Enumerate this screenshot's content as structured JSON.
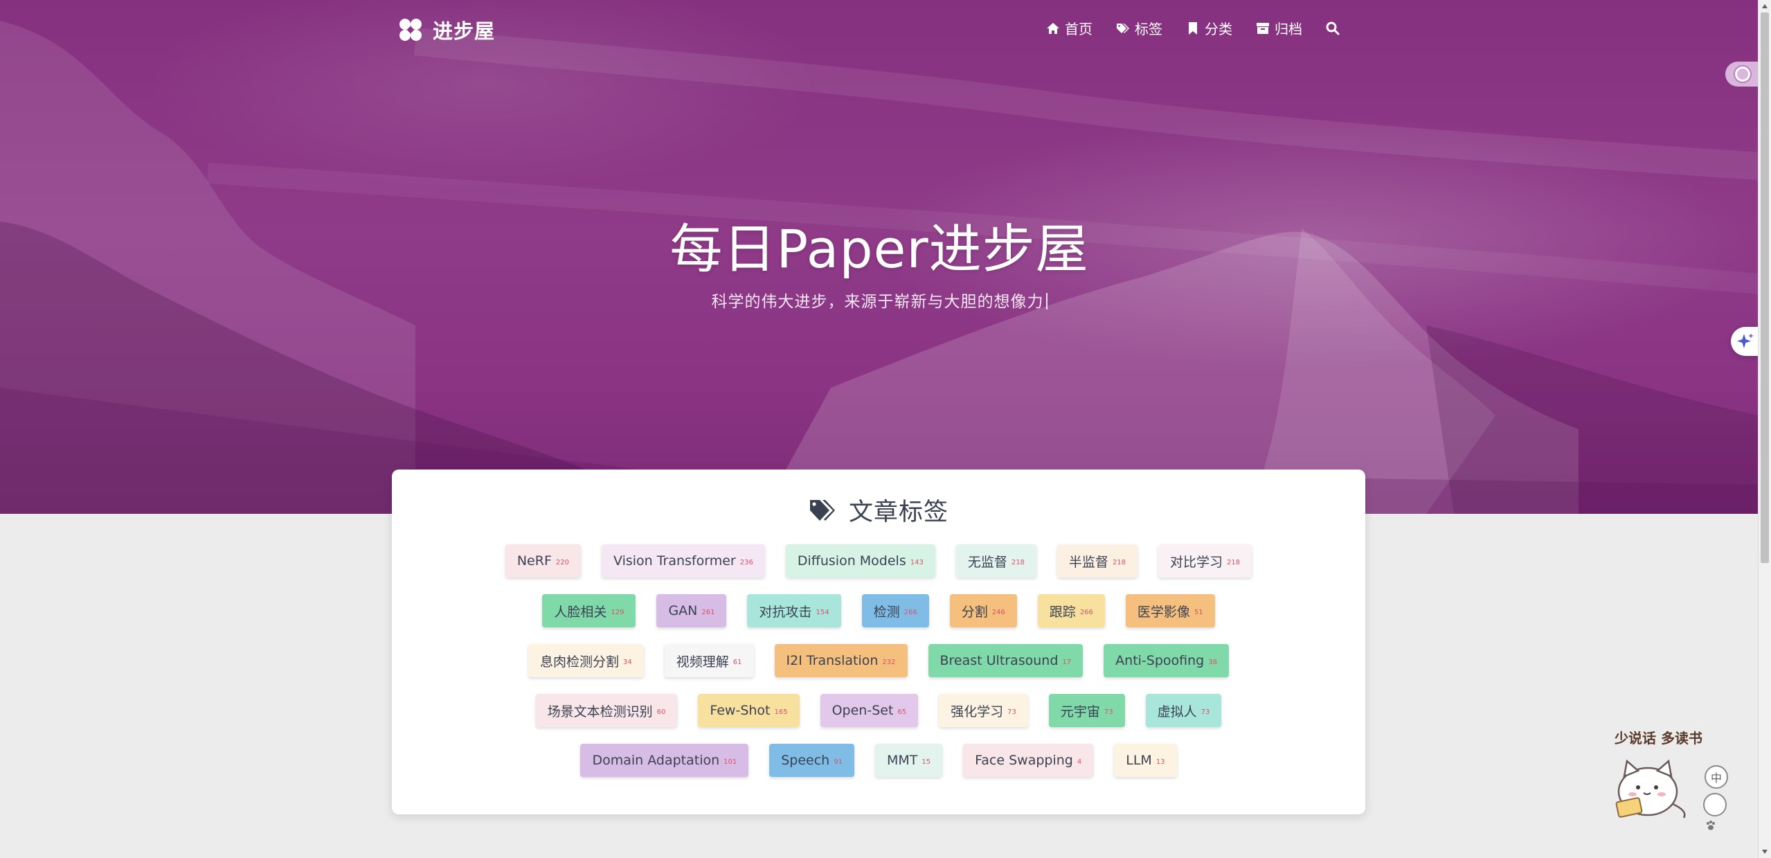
{
  "nav": {
    "site_name": "进步屋",
    "items": [
      {
        "label": "首页",
        "icon": "home-icon"
      },
      {
        "label": "标签",
        "icon": "tags-icon"
      },
      {
        "label": "分类",
        "icon": "bookmark-icon"
      },
      {
        "label": "归档",
        "icon": "archive-icon"
      }
    ],
    "search_icon": "search-icon"
  },
  "hero": {
    "title": "每日Paper进步屋",
    "subtitle": "科学的伟大进步，来源于崭新与大胆的想像力"
  },
  "tags_card": {
    "title": "文章标签",
    "rows": [
      [
        {
          "name": "NeRF",
          "count": "220",
          "color": "#f8e6e8"
        },
        {
          "name": "Vision Transformer",
          "count": "236",
          "color": "#f5e7f3"
        },
        {
          "name": "Diffusion Models",
          "count": "143",
          "color": "#d7f3e6"
        },
        {
          "name": "无监督",
          "count": "218",
          "color": "#e3f4ef"
        },
        {
          "name": "半监督",
          "count": "218",
          "color": "#fcf0e2"
        },
        {
          "name": "对比学习",
          "count": "218",
          "color": "#f9f1f4"
        }
      ],
      [
        {
          "name": "人脸相关",
          "count": "129",
          "color": "#7fd9a8"
        },
        {
          "name": "GAN",
          "count": "261",
          "color": "#d7bde6"
        },
        {
          "name": "对抗攻击",
          "count": "154",
          "color": "#a8e6dc"
        },
        {
          "name": "检测",
          "count": "266",
          "color": "#7fbce6"
        },
        {
          "name": "分割",
          "count": "246",
          "color": "#f5bf7d"
        },
        {
          "name": "跟踪",
          "count": "266",
          "color": "#f8e19f"
        },
        {
          "name": "医学影像",
          "count": "51",
          "color": "#f5bf7d"
        }
      ],
      [
        {
          "name": "息肉检测分割",
          "count": "34",
          "color": "#fcf3e3"
        },
        {
          "name": "视频理解",
          "count": "61",
          "color": "#f6f6f6"
        },
        {
          "name": "I2I Translation",
          "count": "232",
          "color": "#f5bf7d"
        },
        {
          "name": "Breast Ultrasound",
          "count": "17",
          "color": "#7fd9a8"
        },
        {
          "name": "Anti-Spoofing",
          "count": "38",
          "color": "#7fd9a8"
        }
      ],
      [
        {
          "name": "场景文本检测识别",
          "count": "60",
          "color": "#f8e6e8"
        },
        {
          "name": "Few-Shot",
          "count": "165",
          "color": "#f8e19f"
        },
        {
          "name": "Open-Set",
          "count": "65",
          "color": "#e2c8ea"
        },
        {
          "name": "强化学习",
          "count": "73",
          "color": "#fcf3e3"
        },
        {
          "name": "元宇宙",
          "count": "73",
          "color": "#7fd9a8"
        },
        {
          "name": "虚拟人",
          "count": "73",
          "color": "#a8e6dc"
        }
      ],
      [
        {
          "name": "Domain Adaptation",
          "count": "101",
          "color": "#d7bde6"
        },
        {
          "name": "Speech",
          "count": "91",
          "color": "#7fbce6"
        },
        {
          "name": "MMT",
          "count": "15",
          "color": "#e3f4ef"
        },
        {
          "name": "Face Swapping",
          "count": "4",
          "color": "#f8e6e8"
        },
        {
          "name": "LLM",
          "count": "13",
          "color": "#fcf3e3"
        }
      ]
    ]
  },
  "mascot": {
    "text": "少说话 多读书",
    "lang_button": "中"
  },
  "colors": {
    "hero_purple": "#8a3483",
    "tag_count_red": "#d9536b",
    "title_text": "#3a4150"
  }
}
